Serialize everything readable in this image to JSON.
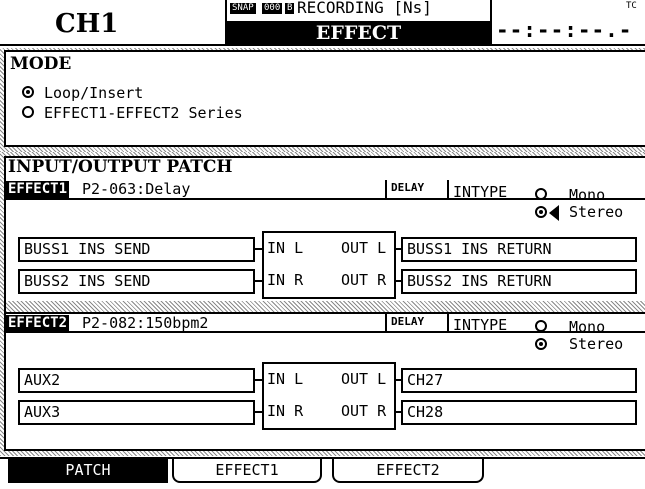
{
  "header": {
    "channel": "CH1",
    "snap_badge": "SNAP",
    "counter_badge": "000",
    "bank_badge": "B",
    "status_line": "RECORDING [Ns]",
    "screen_title": "EFFECT",
    "timecode": "--:--:--.--",
    "tc_label": "TC"
  },
  "mode": {
    "heading": "MODE",
    "options": [
      {
        "label": "Loop/Insert",
        "selected": true
      },
      {
        "label": "EFFECT1-EFFECT2 Series",
        "selected": false
      }
    ]
  },
  "patch": {
    "heading": "INPUT/OUTPUT PATCH",
    "effects": [
      {
        "name": "EFFECT1",
        "preset": "P2-063:Delay",
        "type": "DELAY",
        "intype_label": "INTYPE",
        "mono_label": "Mono",
        "stereo_label": "Stereo",
        "intype_selected": "Stereo",
        "in_l_source": "BUSS1 INS SEND",
        "in_r_source": "BUSS2 INS SEND",
        "out_l_dest": "BUSS1 INS RETURN",
        "out_r_dest": "BUSS2 INS RETURN",
        "in_l": "IN L",
        "in_r": "IN R",
        "out_l": "OUT L",
        "out_r": "OUT R"
      },
      {
        "name": "EFFECT2",
        "preset": "P2-082:150bpm2",
        "type": "DELAY",
        "intype_label": "INTYPE",
        "mono_label": "Mono",
        "stereo_label": "Stereo",
        "intype_selected": "Stereo",
        "in_l_source": "AUX2",
        "in_r_source": "AUX3",
        "out_l_dest": "CH27",
        "out_r_dest": "CH28",
        "in_l": "IN L",
        "in_r": "IN R",
        "out_l": "OUT L",
        "out_r": "OUT R"
      }
    ]
  },
  "tabs": [
    {
      "label": "PATCH",
      "active": true
    },
    {
      "label": "EFFECT1",
      "active": false
    },
    {
      "label": "EFFECT2",
      "active": false
    }
  ]
}
